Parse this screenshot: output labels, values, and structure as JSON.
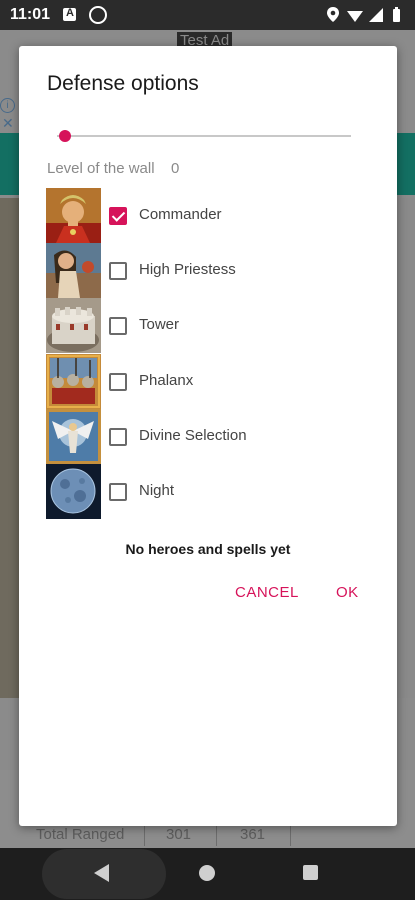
{
  "status_bar": {
    "time": "11:01"
  },
  "background": {
    "ad_label": "Test Ad",
    "total_row": {
      "label": "Total Ranged",
      "value1": "301",
      "value2": "361"
    }
  },
  "dialog": {
    "title": "Defense options",
    "wall_label": "Level of the wall",
    "wall_value": "0",
    "slider_value": 0,
    "options": [
      {
        "label": "Commander",
        "checked": true,
        "icon": "commander-portrait"
      },
      {
        "label": "High Priestess",
        "checked": false,
        "icon": "priestess-portrait"
      },
      {
        "label": "Tower",
        "checked": false,
        "icon": "tower-image"
      },
      {
        "label": "Phalanx",
        "checked": false,
        "icon": "phalanx-image"
      },
      {
        "label": "Divine Selection",
        "checked": false,
        "icon": "angel-image"
      },
      {
        "label": "Night",
        "checked": false,
        "icon": "moon-image"
      }
    ],
    "empty_message": "No heroes and spells yet",
    "cancel_label": "CANCEL",
    "ok_label": "OK"
  },
  "colors": {
    "accent": "#d6135a",
    "teal": "#136f62"
  }
}
